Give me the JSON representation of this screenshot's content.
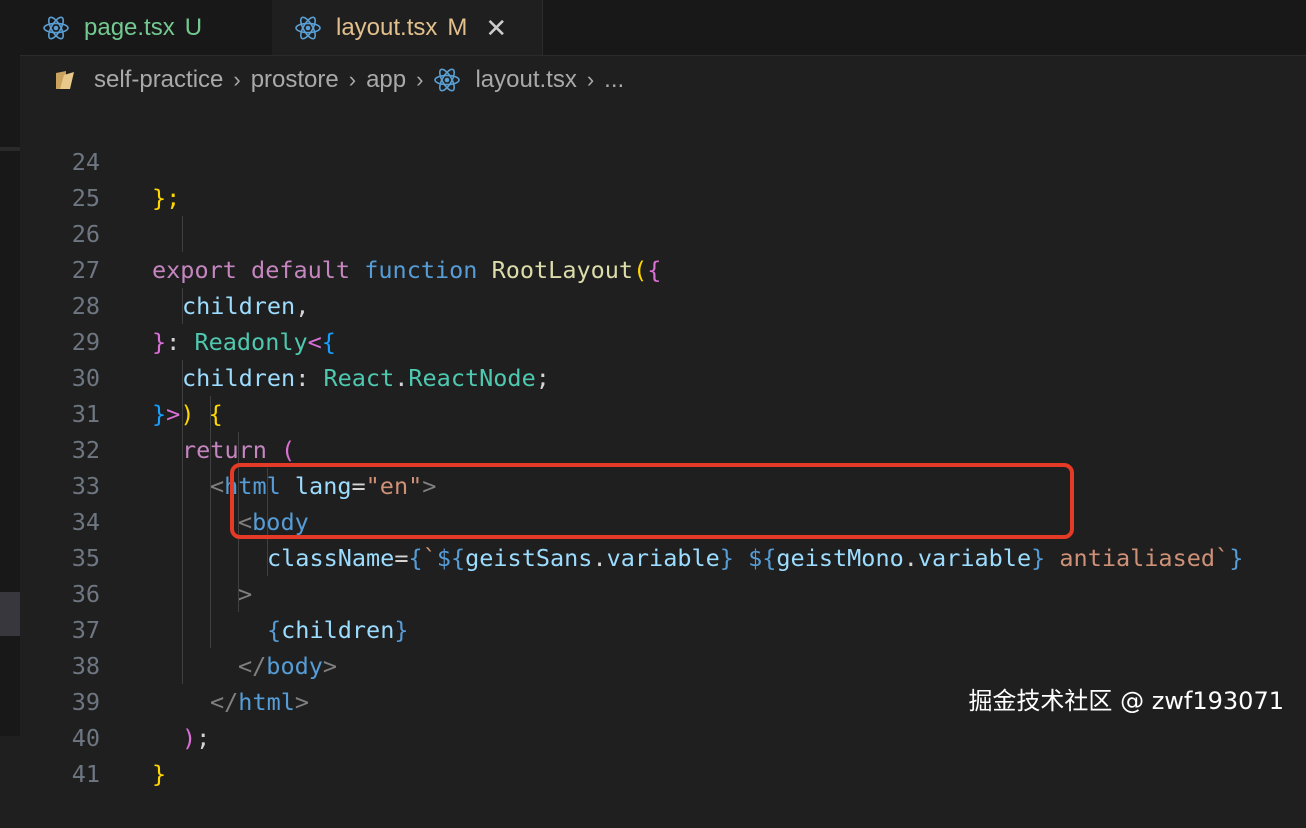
{
  "tabs": [
    {
      "name": "page.tsx",
      "status": "U",
      "active": false
    },
    {
      "name": "layout.tsx",
      "status": "M",
      "active": true
    }
  ],
  "breadcrumb": [
    "self-practice",
    "prostore",
    "app",
    "layout.tsx",
    "..."
  ],
  "colors": {
    "highlight": "#e53a26",
    "untracked": "#73c991",
    "modified": "#e2c08d"
  },
  "icons": {
    "tab_icon": "react-icon",
    "folder_icon": "folder-icon",
    "close": "close-icon"
  },
  "editor": {
    "line_numbers": [
      "24",
      "25",
      "26",
      "27",
      "28",
      "29",
      "30",
      "31",
      "32",
      "33",
      "34",
      "35",
      "36",
      "37",
      "38",
      "39",
      "40",
      "41"
    ],
    "lines": {
      "l24": {
        "a": "};"
      },
      "l26": {
        "export": "export",
        "default": "default",
        "function": "function",
        "name": "RootLayout",
        "paren": "(",
        "brace": "{"
      },
      "l27": {
        "children": "children",
        "comma": ","
      },
      "l28": {
        "close": "}",
        "colon": ": ",
        "type": "Readonly",
        "lt": "<",
        "brace": "{"
      },
      "l29": {
        "children": "children",
        "colon": ": ",
        "react": "React",
        "dot": ".",
        "node": "ReactNode",
        "semi": ";"
      },
      "l30": {
        "close": "}",
        "gt": ">",
        "paren": ")",
        "space": " ",
        "brace": "{"
      },
      "l31": {
        "return": "return",
        "space": " ",
        "paren": "("
      },
      "l32": {
        "lt": "<",
        "tag": "html",
        "space": " ",
        "attr": "lang",
        "eq": "=",
        "val": "\"en\"",
        "gt": ">"
      },
      "l33": {
        "lt": "<",
        "tag": "body"
      },
      "l34": {
        "attr": "className",
        "eq": "=",
        "b1": "{",
        "bt": "`",
        "d1": "${",
        "v1": "geistSans",
        "dot1": ".",
        "p1": "variable",
        "c1": "}",
        "sp": " ",
        "d2": "${",
        "v2": "geistMono",
        "dot2": ".",
        "p2": "variable",
        "c2": "}",
        "rest": " antialiased`",
        "b2": "}"
      },
      "l35": {
        "gt": ">"
      },
      "l36": {
        "o": "{",
        "children": "children",
        "c": "}"
      },
      "l37": {
        "lt": "</",
        "tag": "body",
        "gt": ">"
      },
      "l38": {
        "lt": "</",
        "tag": "html",
        "gt": ">"
      },
      "l39": {
        "paren": ")",
        "semi": ";"
      },
      "l40": {
        "brace": "}"
      }
    }
  },
  "watermark": "掘金技术社区 @ zwf193071"
}
